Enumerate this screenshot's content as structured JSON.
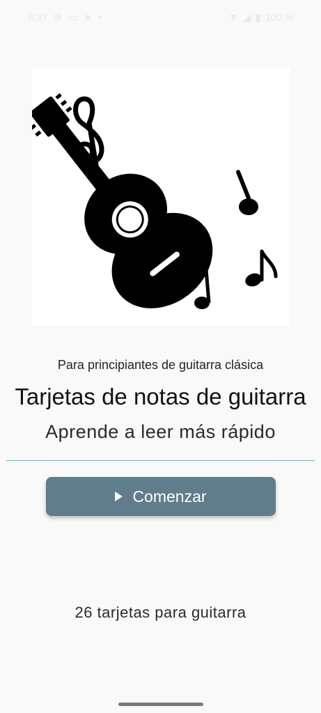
{
  "status_bar": {
    "time": "6:37",
    "battery": "100 %"
  },
  "hero": {
    "image_icons": [
      "guitar-icon",
      "treble-clef-icon",
      "quarter-note-icon",
      "eighth-note-icon",
      "beamed-notes-icon"
    ]
  },
  "main": {
    "subtitle": "Para principiantes de guitarra clásica",
    "title": "Tarjetas de notas de guitarra",
    "tagline": "Aprende a leer más rápido",
    "start_button_label": "Comenzar",
    "card_count": "26 tarjetas para guitarra"
  },
  "colors": {
    "background": "#f9f9f9",
    "button": "#607d8b",
    "divider": "#48bfcf",
    "illustration": "#000000"
  }
}
